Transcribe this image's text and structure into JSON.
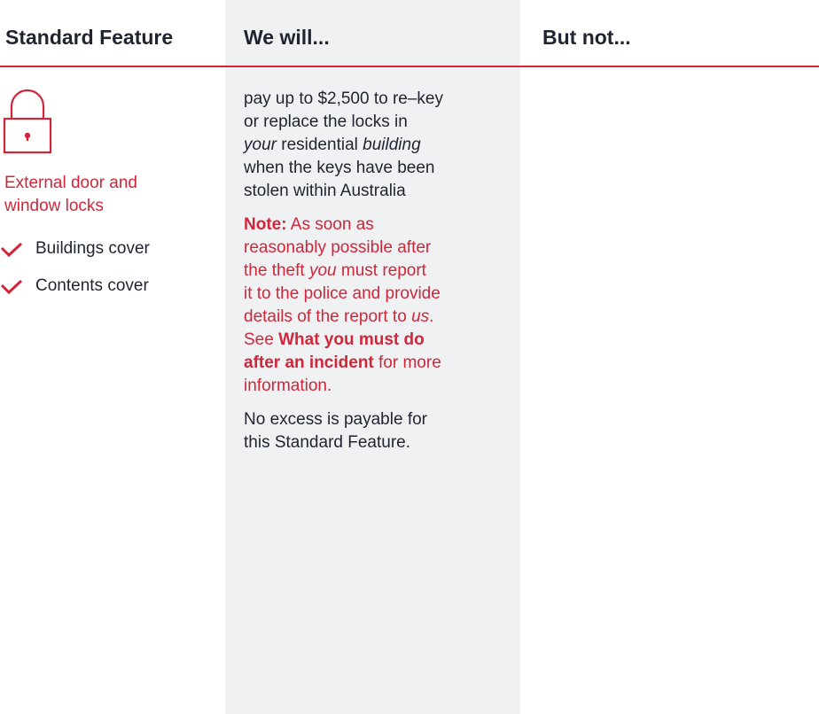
{
  "header": {
    "col1": "Standard Feature",
    "col2": "We will...",
    "col3": "But not..."
  },
  "feature": {
    "icon": "lock-icon",
    "title_line1": "External door and",
    "title_line2": "window locks",
    "covers": [
      {
        "icon": "checkmark-icon",
        "label": "Buildings cover"
      },
      {
        "icon": "checkmark-icon",
        "label": "Contents cover"
      }
    ]
  },
  "we_will": {
    "main": {
      "l1": "pay up to $2,500 to re–key",
      "l2": "or replace the locks in",
      "l3_italic": "your",
      "l3_rest": " residential ",
      "l3_italic2": "building",
      "l4": "when the keys have been",
      "l5": "stolen within Australia"
    },
    "note": {
      "label": "Note:",
      "l1": " As soon as",
      "l2": "reasonably possible after",
      "l3a": "the theft ",
      "l3_italic": "you",
      "l3b": " must report",
      "l4": "it to the police and provide",
      "l5a": "details of the report to ",
      "l5_italic": "us",
      "l5b": ".",
      "l6a": "See ",
      "l6_bold": "What you must do",
      "l7_bold": "after an incident",
      "l7b": " for more",
      "l8": "information."
    },
    "excess": {
      "l1": "No excess is payable for",
      "l2": "this Standard Feature."
    }
  },
  "but_not": {},
  "colors": {
    "accent": "#d0263a",
    "text": "#1f2430",
    "shaded_column": "#f0f1f3"
  }
}
